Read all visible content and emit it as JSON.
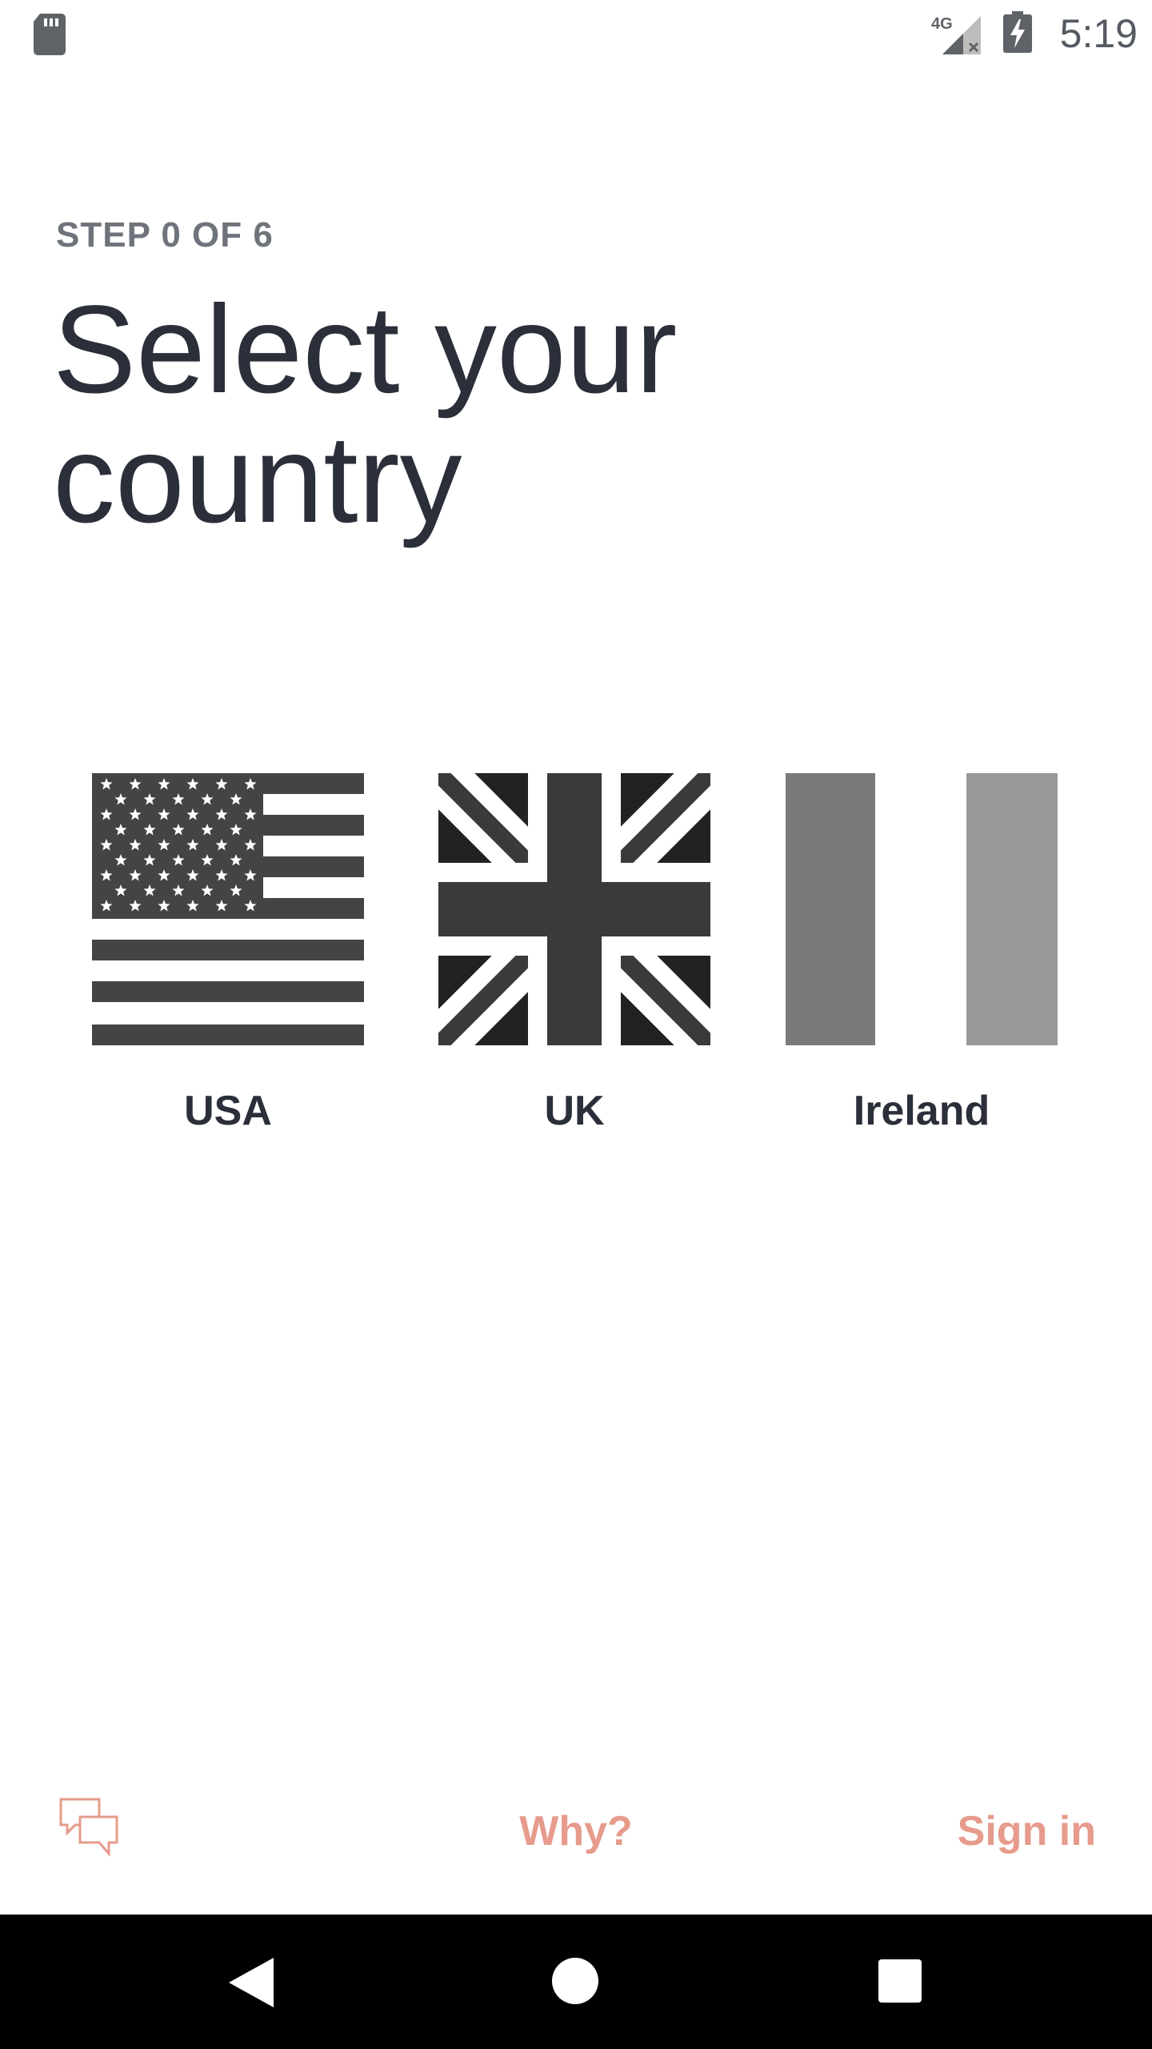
{
  "status_bar": {
    "time": "5:19",
    "network_label": "4G",
    "icons": [
      "sd-card-icon",
      "cellular-signal-icon",
      "battery-charging-icon"
    ]
  },
  "header": {
    "step": "STEP 0 OF 6",
    "title": "Select your country"
  },
  "countries": [
    {
      "name": "USA",
      "flag_icon": "usa-flag-icon"
    },
    {
      "name": "UK",
      "flag_icon": "uk-flag-icon"
    },
    {
      "name": "Ireland",
      "flag_icon": "ireland-flag-icon"
    }
  ],
  "footer": {
    "chat_icon": "chat-bubbles-icon",
    "why_label": "Why?",
    "signin_label": "Sign in"
  },
  "nav_bar": {
    "icons": [
      "back-icon",
      "home-icon",
      "recents-icon"
    ]
  },
  "colors": {
    "accent": "#e69b8c",
    "title_text": "#2b2f3a",
    "step_text": "#6f737b",
    "nav_background": "#000000"
  }
}
